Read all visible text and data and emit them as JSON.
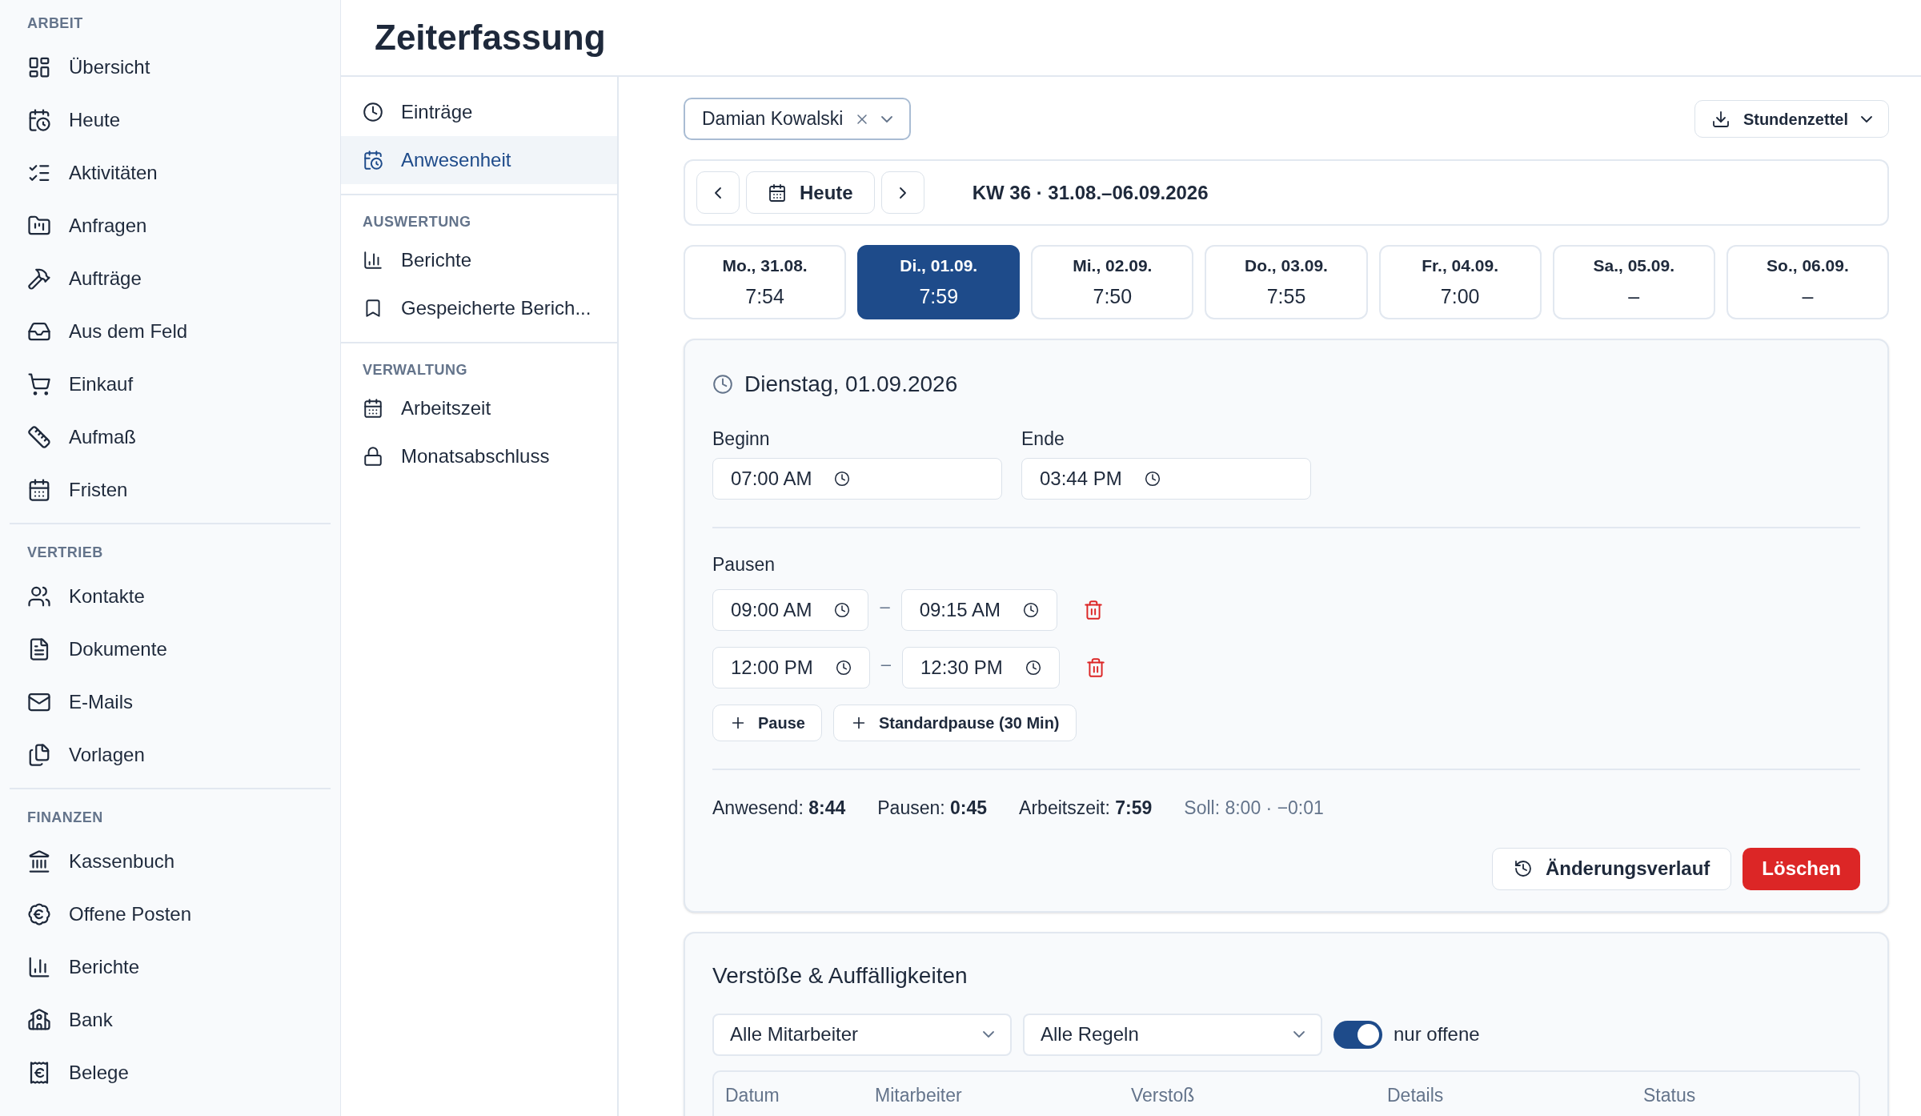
{
  "sidebar": {
    "sections": [
      {
        "title": "ARBEIT",
        "items": [
          {
            "label": "Übersicht",
            "selected": false
          },
          {
            "label": "Heute",
            "selected": false
          },
          {
            "label": "Aktivitäten",
            "selected": false
          },
          {
            "label": "Anfragen",
            "selected": false
          },
          {
            "label": "Aufträge",
            "selected": false
          },
          {
            "label": "Aus dem Feld",
            "selected": false
          },
          {
            "label": "Einkauf",
            "selected": false
          },
          {
            "label": "Aufmaß",
            "selected": false
          },
          {
            "label": "Fristen",
            "selected": false
          }
        ]
      },
      {
        "title": "VERTRIEB",
        "items": [
          {
            "label": "Kontakte",
            "selected": false
          },
          {
            "label": "Dokumente",
            "selected": false
          },
          {
            "label": "E-Mails",
            "selected": false
          },
          {
            "label": "Vorlagen",
            "selected": false
          }
        ]
      },
      {
        "title": "FINANZEN",
        "items": [
          {
            "label": "Kassenbuch",
            "selected": false
          },
          {
            "label": "Offene Posten",
            "selected": false
          },
          {
            "label": "Berichte",
            "selected": false
          },
          {
            "label": "Bank",
            "selected": false
          },
          {
            "label": "Belege",
            "selected": false
          }
        ]
      }
    ]
  },
  "page_title": "Zeiterfassung",
  "subnav": {
    "sections": [
      {
        "items": [
          {
            "label": "Einträge",
            "selected": false
          },
          {
            "label": "Anwesenheit",
            "selected": true
          }
        ]
      },
      {
        "title": "AUSWERTUNG",
        "items": [
          {
            "label": "Berichte",
            "selected": false
          },
          {
            "label": "Gespeicherte Berich...",
            "selected": false
          }
        ]
      },
      {
        "title": "VERWALTUNG",
        "items": [
          {
            "label": "Arbeitszeit",
            "selected": false
          },
          {
            "label": "Monatsabschluss",
            "selected": false
          }
        ]
      }
    ]
  },
  "employee_filter": {
    "value": "Damian Kowalski"
  },
  "export_button": "Stundenzettel",
  "week_nav": {
    "today_button": "Heute",
    "week_label": "KW 36 · 31.08.–06.09.2026"
  },
  "days": [
    {
      "label": "Mo., 31.08.",
      "value": "7:54",
      "selected": false
    },
    {
      "label": "Di., 01.09.",
      "value": "7:59",
      "selected": true
    },
    {
      "label": "Mi., 02.09.",
      "value": "7:50",
      "selected": false
    },
    {
      "label": "Do., 03.09.",
      "value": "7:55",
      "selected": false
    },
    {
      "label": "Fr., 04.09.",
      "value": "7:00",
      "selected": false
    },
    {
      "label": "Sa., 05.09.",
      "value": "–",
      "selected": false
    },
    {
      "label": "So., 06.09.",
      "value": "–",
      "selected": false
    }
  ],
  "day_detail": {
    "title": "Dienstag, 01.09.2026",
    "begin": {
      "label": "Beginn",
      "value": "07:00 AM"
    },
    "end": {
      "label": "Ende",
      "value": "03:44 PM"
    },
    "breaks_label": "Pausen",
    "breaks": [
      {
        "start": "09:00 AM",
        "separator": "–",
        "end": "09:15 AM"
      },
      {
        "start": "12:00 PM",
        "separator": "–",
        "end": "12:30 PM"
      }
    ],
    "add_buttons": [
      "Pause",
      "Standardpause (30 Min)"
    ],
    "summary": [
      "Anwesend: **8:44**",
      "Pausen: **0:45**",
      "Arbeitszeit: **7:59**"
    ],
    "target": "Soll: 8:00 · −0:01",
    "history_button": "Änderungsverlauf",
    "delete_button": "Löschen"
  },
  "violations": {
    "title": "Verstöße & Auffälligkeiten",
    "employee_select": "Alle Mitarbeiter",
    "rule_select": "Alle Regeln",
    "only_open": {
      "label": "nur offene",
      "on": true
    },
    "table": {
      "columns": [
        "Datum",
        "Mitarbeiter",
        "Verstoß",
        "Details",
        "Status"
      ]
    }
  }
}
